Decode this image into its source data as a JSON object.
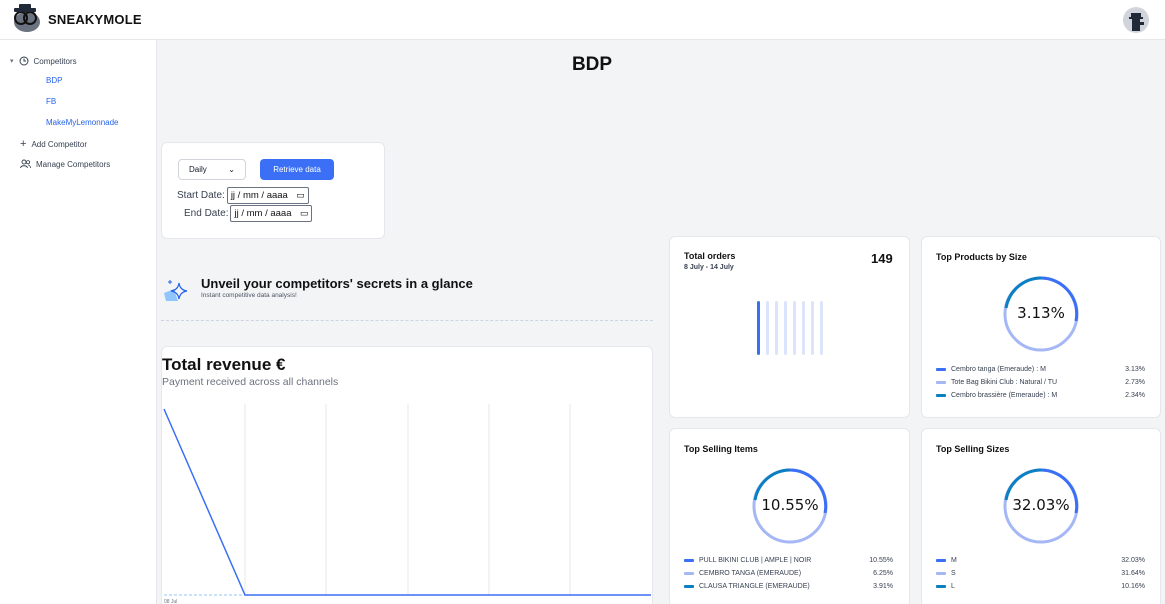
{
  "brand": {
    "name": "SNEAKYMOLE"
  },
  "sidebar": {
    "section_label": "Competitors",
    "competitors": [
      "BDP",
      "FB",
      "MakeMyLemonnade"
    ],
    "add_label": "Add Competitor",
    "manage_label": "Manage Competitors"
  },
  "page": {
    "title": "BDP"
  },
  "filters": {
    "granularity": "Daily",
    "retrieve_label": "Retrieve data",
    "start_label": "Start Date:",
    "end_label": "End Date:",
    "date_placeholder": "jj / mm / aaaa"
  },
  "promo": {
    "title": "Unveil your competitors' secrets in a glance",
    "subtitle": "Instant competitive data analysis!"
  },
  "revenue": {
    "title": "Total revenue €",
    "subtitle": "Payment received across all channels",
    "x_first_label": "08 Jul"
  },
  "orders": {
    "title": "Total orders",
    "range": "8 July - 14 July",
    "total": "149"
  },
  "top_products": {
    "title": "Top Products by Size",
    "center": "3.13%",
    "items": [
      {
        "name": "Cembro tanga (Emeraude) : M",
        "value": "3.13%",
        "color": "#3b6ff5"
      },
      {
        "name": "Tote Bag Bikini Club : Natural / TU",
        "value": "2.73%",
        "color": "#a5b8f5"
      },
      {
        "name": "Cembro brassière (Emeraude) : M",
        "value": "2.34%",
        "color": "#0b7fc0"
      }
    ]
  },
  "top_items": {
    "title": "Top Selling Items",
    "center": "10.55%",
    "items": [
      {
        "name": "PULL BIKINI CLUB | AMPLE | NOIR",
        "value": "10.55%",
        "color": "#3b6ff5"
      },
      {
        "name": "CEMBRO TANGA (EMERAUDE)",
        "value": "6.25%",
        "color": "#a5b8f5"
      },
      {
        "name": "CLAUSA TRIANGLE (EMERAUDE)",
        "value": "3.91%",
        "color": "#0b7fc0"
      }
    ]
  },
  "top_sizes": {
    "title": "Top Selling Sizes",
    "center": "32.03%",
    "items": [
      {
        "name": "M",
        "value": "32.03%",
        "color": "#3b6ff5"
      },
      {
        "name": "S",
        "value": "31.64%",
        "color": "#a5b8f5"
      },
      {
        "name": "L",
        "value": "10.16%",
        "color": "#0b7fc0"
      }
    ]
  }
}
